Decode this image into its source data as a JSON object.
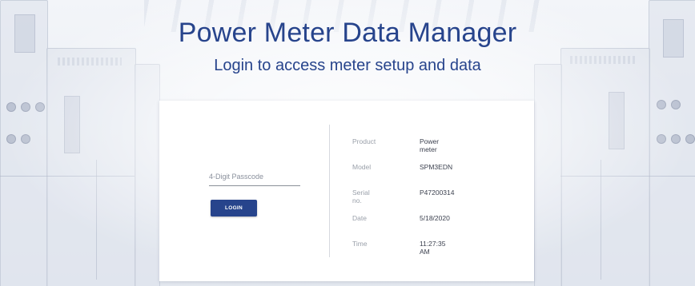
{
  "header": {
    "title": "Power Meter Data Manager",
    "subtitle": "Login to access meter setup and data"
  },
  "login": {
    "passcode_label": "4-Digit Passcode",
    "passcode_value": "",
    "button_label": "LOGIN"
  },
  "device_info": [
    {
      "label": "Product",
      "value": "Power meter"
    },
    {
      "label": "Model",
      "value": "SPM3EDN"
    },
    {
      "label": "Serial no.",
      "value": "P47200314"
    },
    {
      "label": "Date",
      "value": "5/18/2020"
    },
    {
      "label": "Time",
      "value": "11:27:35 AM"
    }
  ],
  "colors": {
    "brand": "#27448c",
    "card": "#ffffff",
    "label": "#9aa0aa"
  }
}
